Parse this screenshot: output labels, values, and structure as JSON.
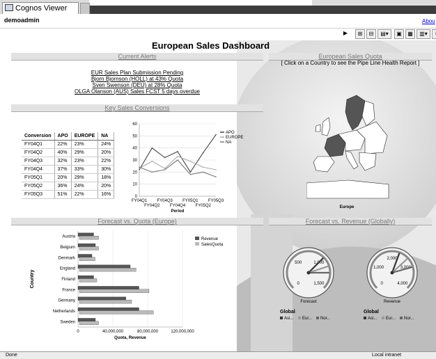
{
  "app": {
    "tab_title": "Cognos Viewer",
    "user": "demoadmin",
    "about_link": "Abou"
  },
  "dashboard": {
    "title": "European Sales Dashboard"
  },
  "sections": {
    "current_alerts": "Current Alerts",
    "european_sales_quota": "European Sales Quota",
    "quota_instruction": "[ Click on a Country to see the Pipe Line Health Report ]",
    "key_sales_conversions": "Key Sales Conversions",
    "forecast_vs_quota": "Forecast vs. Quota (Europe)",
    "forecast_vs_revenue": "Forecast vs. Revenue (Globally)"
  },
  "alerts": [
    "EUR Sales Plan Submission Pending",
    "Bjorn Bjornson (HOLL) at 43% Quota",
    "Sven Swenson (DEU) at 28% Quota",
    "OLGA Olanson (AUS) Sales FCST 5 days overdue"
  ],
  "conversion_table": {
    "headers": [
      "Conversion",
      "APO",
      "EUROPE",
      "NA"
    ],
    "rows": [
      [
        "FY04Q1",
        "22%",
        "23%",
        "24%"
      ],
      [
        "FY04Q2",
        "40%",
        "29%",
        "20%"
      ],
      [
        "FY04Q3",
        "32%",
        "23%",
        "22%"
      ],
      [
        "FY04Q4",
        "37%",
        "33%",
        "30%"
      ],
      [
        "FY05Q1",
        "20%",
        "29%",
        "18%"
      ],
      [
        "FY05Q2",
        "36%",
        "24%",
        "20%"
      ],
      [
        "FY05Q3",
        "51%",
        "22%",
        "16%"
      ]
    ]
  },
  "map": {
    "label": "Europe",
    "highlight_color": "#555555",
    "land_color": "#ffffff"
  },
  "status_bar": {
    "left": "Done",
    "right": "Local intranet"
  },
  "chart_data": [
    {
      "type": "line",
      "x": [
        "FY04Q1",
        "FY04Q2",
        "FY04Q3",
        "FY04Q4",
        "FY05Q1",
        "FY05Q2",
        "FY05Q3"
      ],
      "xlabel": "Period",
      "ylim": [
        0,
        60
      ],
      "yticks": [
        0,
        10,
        20,
        30,
        40,
        50,
        60
      ],
      "series": [
        {
          "name": "APO",
          "values": [
            22,
            40,
            32,
            37,
            20,
            36,
            51
          ],
          "color": "#444444"
        },
        {
          "name": "EUROPE",
          "values": [
            23,
            29,
            23,
            33,
            29,
            24,
            22
          ],
          "color": "#aaaaaa"
        },
        {
          "name": "NA",
          "values": [
            24,
            20,
            22,
            30,
            18,
            20,
            16
          ],
          "color": "#777777"
        }
      ],
      "legend": "right"
    },
    {
      "type": "bar",
      "orientation": "horizontal",
      "categories": [
        "Austria",
        "Belgium",
        "Denmark",
        "England",
        "Finland",
        "France",
        "Germany",
        "Netherlands",
        "Sweden"
      ],
      "series": [
        {
          "name": "Revenue",
          "values": [
            18000000,
            20000000,
            16000000,
            60000000,
            18000000,
            70000000,
            55000000,
            70000000,
            20000000
          ],
          "color": "#555555"
        },
        {
          "name": "SalesQuota",
          "values": [
            22000000,
            22000000,
            18000000,
            65000000,
            20000000,
            80000000,
            60000000,
            85000000,
            22000000
          ],
          "color": "#bbbbbb"
        }
      ],
      "xlabel": "Quota, Revenue",
      "ylabel": "Country",
      "xlim": [
        0,
        120000000
      ],
      "xticks": [
        "0",
        "40,000,000",
        "80,000,000",
        "120,000,000"
      ],
      "legend": "top-right"
    },
    {
      "type": "gauge",
      "title": "Forecast",
      "ticks": [
        "0",
        "500",
        "1,000",
        "1,500"
      ],
      "max": 1500,
      "needles": [
        1000,
        1150,
        1250
      ],
      "caption": "Global",
      "legend": [
        "Asi...",
        "Eur...",
        "Nor..."
      ]
    },
    {
      "type": "gauge",
      "title": "Revenue",
      "ticks": [
        "0",
        "1,000",
        "2,000",
        "3,000",
        "4,000"
      ],
      "max": 4000,
      "needles": [
        2300,
        2700,
        3100
      ],
      "caption": "Global",
      "legend": [
        "Asi...",
        "Eur...",
        "Nor..."
      ]
    }
  ]
}
